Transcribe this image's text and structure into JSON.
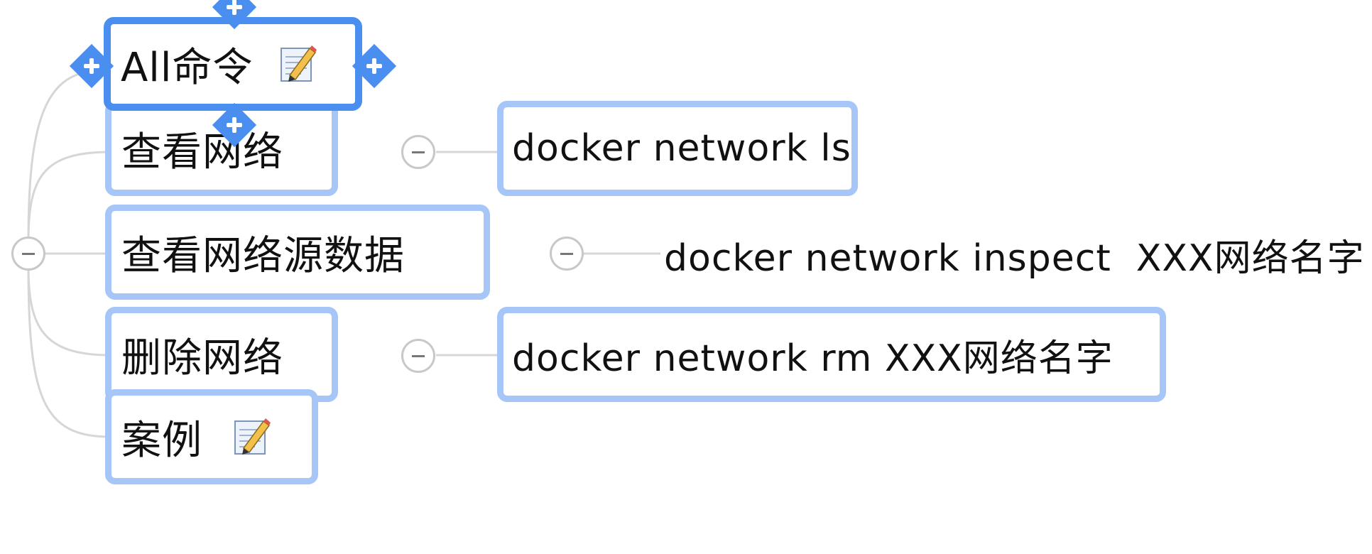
{
  "central_topic": {
    "label": "All命令",
    "has_note": true,
    "note_icon": "note-pencil-icon"
  },
  "topics": [
    {
      "label": "查看网络",
      "children": [
        {
          "label": "docker network ls"
        }
      ]
    },
    {
      "label": "查看网络源数据",
      "children": [
        {
          "label": "docker network inspect  XXX网络名字"
        }
      ]
    },
    {
      "label": "删除网络",
      "children": [
        {
          "label": "docker network rm XXX网络名字"
        }
      ]
    },
    {
      "label": "案例",
      "has_note": true,
      "note_icon": "note-pencil-icon",
      "children": []
    }
  ],
  "colors": {
    "topic_border": "#a6c6f7",
    "selected_border": "#4a8ff0",
    "connector": "#d6d6d6"
  }
}
